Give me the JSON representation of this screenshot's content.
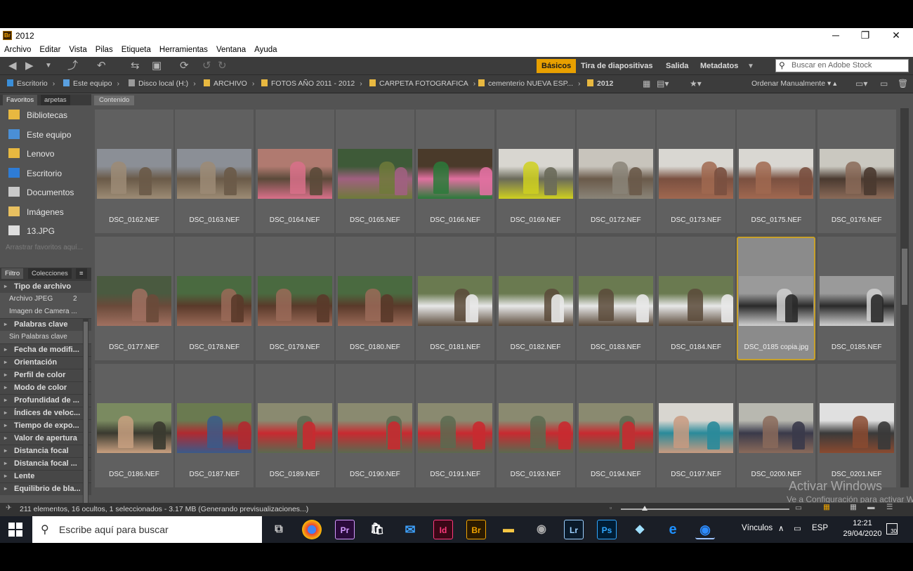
{
  "window": {
    "title": "2012",
    "controls": {
      "minimize": "─",
      "maximize": "❐",
      "close": "✕"
    }
  },
  "menu": [
    "Archivo",
    "Editar",
    "Vista",
    "Pilas",
    "Etiqueta",
    "Herramientas",
    "Ventana",
    "Ayuda"
  ],
  "workspaces": {
    "basicos": "Básicos",
    "tira": "Tira de diapositivas",
    "salida": "Salida",
    "metadatos": "Metadatos"
  },
  "stock_search": {
    "placeholder": "Buscar en Adobe Stock"
  },
  "breadcrumb": [
    "Escritorio",
    "Este equipo",
    "Disco local (H:)",
    "ARCHIVO",
    "FOTOS AÑO 2011 - 2012",
    "CARPETA FOTOGRAFICA",
    "cementerio NUEVA ESP...",
    "2012"
  ],
  "sort": {
    "label": "Ordenar Manualmente"
  },
  "left_tabs": {
    "favoritos": "Favoritos",
    "carpetas": "arpetas"
  },
  "favorites": [
    "Bibliotecas",
    "Este equipo",
    "Lenovo",
    "Escritorio",
    "Documentos",
    "Imágenes",
    "13.JPG"
  ],
  "drag_hint": "Arrastrar favoritos aquí...",
  "filter_tabs": {
    "filtro": "Filtro",
    "colecciones": "Colecciones"
  },
  "filters": [
    {
      "kind": "hdr",
      "label": "Tipo de archivo"
    },
    {
      "kind": "item",
      "label": "Archivo JPEG",
      "count": "2"
    },
    {
      "kind": "item",
      "label": "Imagen de Camera ...",
      "count": ""
    },
    {
      "kind": "hdr",
      "label": "Palabras clave"
    },
    {
      "kind": "item",
      "label": "Sin Palabras clave",
      "count": ""
    },
    {
      "kind": "hdr",
      "label": "Fecha de modifi..."
    },
    {
      "kind": "hdr",
      "label": "Orientación"
    },
    {
      "kind": "hdr",
      "label": "Perfil de color"
    },
    {
      "kind": "hdr",
      "label": "Modo de color"
    },
    {
      "kind": "hdr",
      "label": "Profundidad de ..."
    },
    {
      "kind": "hdr",
      "label": "Índices de veloc..."
    },
    {
      "kind": "hdr",
      "label": "Tiempo de expo..."
    },
    {
      "kind": "hdr",
      "label": "Valor de apertura"
    },
    {
      "kind": "hdr",
      "label": "Distancia focal"
    },
    {
      "kind": "hdr",
      "label": "Distancia focal ..."
    },
    {
      "kind": "hdr",
      "label": "Lente"
    },
    {
      "kind": "hdr",
      "label": "Equilibrio de bla..."
    }
  ],
  "content_tab": "Contenido",
  "files": [
    "DSC_0162.NEF",
    "DSC_0163.NEF",
    "DSC_0164.NEF",
    "DSC_0165.NEF",
    "DSC_0166.NEF",
    "DSC_0169.NEF",
    "DSC_0172.NEF",
    "DSC_0173.NEF",
    "DSC_0175.NEF",
    "DSC_0176.NEF",
    "DSC_0177.NEF",
    "DSC_0178.NEF",
    "DSC_0179.NEF",
    "DSC_0180.NEF",
    "DSC_0181.NEF",
    "DSC_0182.NEF",
    "DSC_0183.NEF",
    "DSC_0184.NEF",
    "DSC_0185 copia.jpg",
    "DSC_0185.NEF",
    "DSC_0186.NEF",
    "DSC_0187.NEF",
    "DSC_0189.NEF",
    "DSC_0190.NEF",
    "DSC_0191.NEF",
    "DSC_0193.NEF",
    "DSC_0194.NEF",
    "DSC_0197.NEF",
    "DSC_0200.NEF",
    "DSC_0201.NEF"
  ],
  "selected_file": "DSC_0185 copia.jpg",
  "status": "211 elementos, 16 ocultos, 1 seleccionados - 3.17 MB (Generando previsualizaciones...)",
  "watermark": {
    "line1": "Activar Windows",
    "line2": "Ve a Configuración para activar Windows."
  },
  "taskbar": {
    "search_placeholder": "Escribe aquí para buscar",
    "apps": [
      "Pr",
      "Id",
      "Br",
      "Lr",
      "Ps"
    ],
    "vinculos": "Vínculos",
    "lang": "ESP",
    "time": "12:21",
    "date": "29/04/2020",
    "notifications": "30"
  },
  "colors": {
    "accent": "#e8a000",
    "selection_border": "#c8a12a",
    "panel": "#535353"
  }
}
